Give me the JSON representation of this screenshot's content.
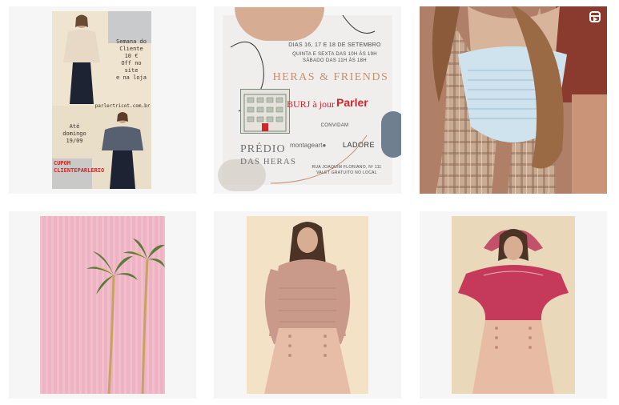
{
  "grid": {
    "posts": [
      {
        "type": "image",
        "lines_top": [
          "Semana do",
          "Cliente",
          "10 €",
          "Off no site",
          "e na loja"
        ],
        "site": "parlertricot.com.br",
        "lines_mid": [
          "Até",
          "domingo",
          "19/09"
        ],
        "coupon": [
          "CUPOM",
          "CLIENTEPARLERIO"
        ]
      },
      {
        "type": "image",
        "dates": "DIAS 16, 17 E 18 DE SETEMBRO",
        "hours1": "QUINTA E SEXTA DAS 10H ÀS 19H",
        "hours2": "SÁBADO DAS 11H ÀS 18H",
        "event": "HERAS & FRIENDS",
        "burj": "BURJ à jour",
        "parler": "Parler",
        "convidam": "CONVIDAM",
        "montage": "montageart●",
        "ladore": "LADORE",
        "predio": "PRÉDIO",
        "das_heras": "DAS HERAS",
        "address1": "RUA JOAQUIM FLORIANO, Nº 111",
        "address2": "VALET GRATUITO NO LOCAL"
      },
      {
        "type": "reel",
        "icon": "reels-icon"
      },
      {
        "type": "image"
      },
      {
        "type": "image"
      },
      {
        "type": "image"
      }
    ]
  },
  "colors": {
    "accent_red": "#d2262a",
    "heras_gold": "#c58f6e"
  }
}
